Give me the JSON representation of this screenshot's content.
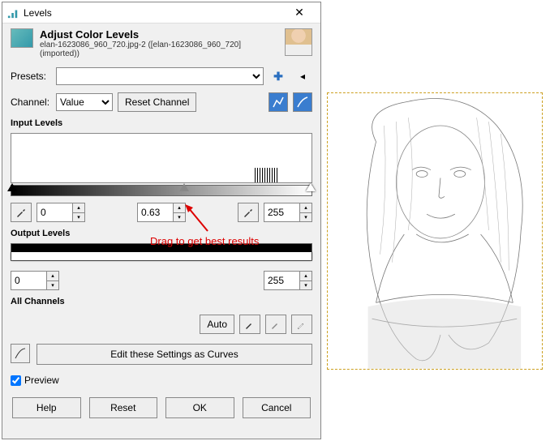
{
  "window": {
    "title": "Levels",
    "heading": "Adjust Color Levels",
    "subtitle": "elan-1623086_960_720.jpg-2 ([elan-1623086_960_720] (imported))"
  },
  "presets": {
    "label": "Presets:"
  },
  "channel": {
    "label": "Channel:",
    "value": "Value",
    "reset": "Reset Channel"
  },
  "input": {
    "label": "Input Levels",
    "low": "0",
    "gamma": "0.63",
    "high": "255"
  },
  "output": {
    "label": "Output Levels",
    "low": "0",
    "high": "255"
  },
  "allchannels": {
    "label": "All Channels",
    "auto": "Auto"
  },
  "curves": {
    "label": "Edit these Settings as Curves"
  },
  "preview": {
    "label": "Preview",
    "checked": true
  },
  "footer": {
    "help": "Help",
    "reset": "Reset",
    "ok": "OK",
    "cancel": "Cancel"
  },
  "annotation": {
    "text": "Drag to get best results"
  }
}
